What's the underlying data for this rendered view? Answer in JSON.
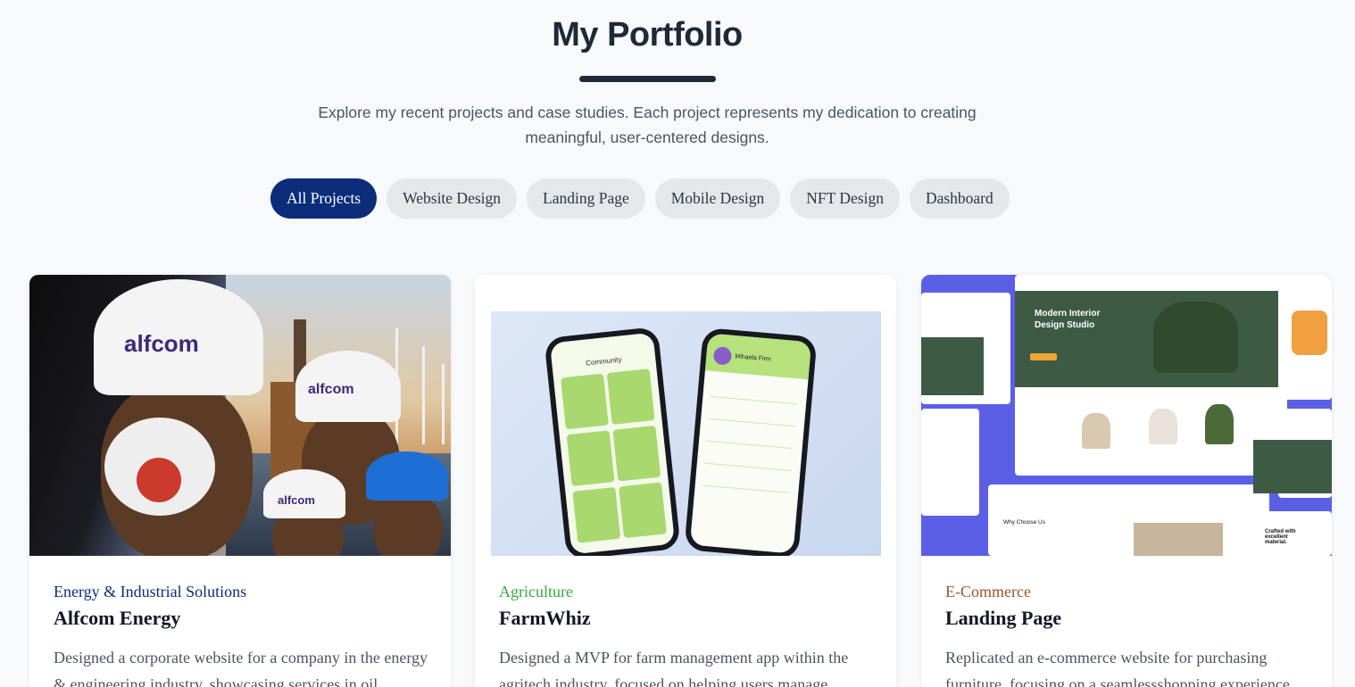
{
  "header": {
    "title": "My Portfolio",
    "subtitle_line1": "Explore my recent projects and case studies. Each project represents my dedication to creating",
    "subtitle_line2": "meaningful, user-centered designs."
  },
  "filters": [
    {
      "label": "All Projects",
      "active": true
    },
    {
      "label": "Website Design",
      "active": false
    },
    {
      "label": "Landing Page",
      "active": false
    },
    {
      "label": "Mobile Design",
      "active": false
    },
    {
      "label": "NFT Design",
      "active": false
    },
    {
      "label": "Dashboard",
      "active": false
    }
  ],
  "projects": [
    {
      "category": "Energy & Industrial Solutions",
      "category_color": "#0b2d7a",
      "title": "Alfcom Energy",
      "description": "Designed a corporate website for a company in the energy & engineering industry, showcasing services in oil",
      "image_text": "alfcom"
    },
    {
      "category": "Agriculture",
      "category_color": "#3aa83a",
      "title": "FarmWhiz",
      "description": "Designed a MVP for farm management app within the agritech industry, focused on helping users manage",
      "image_text_1": "Community",
      "image_text_2": "Mihaela Firm"
    },
    {
      "category": "E-Commerce",
      "category_color": "#a0522d",
      "title": "Landing Page",
      "description": "Replicated an e-commerce website for purchasing furniture, focusing on a seamlessshopping experience.",
      "image_text_1": "Modern Interior",
      "image_text_2": "Design Studio",
      "image_text_3": "Why Choose Us",
      "image_text_4": "Crafted with excellent material."
    }
  ],
  "colors": {
    "accent": "#0b2d7a",
    "background": "#f8f9fb"
  }
}
